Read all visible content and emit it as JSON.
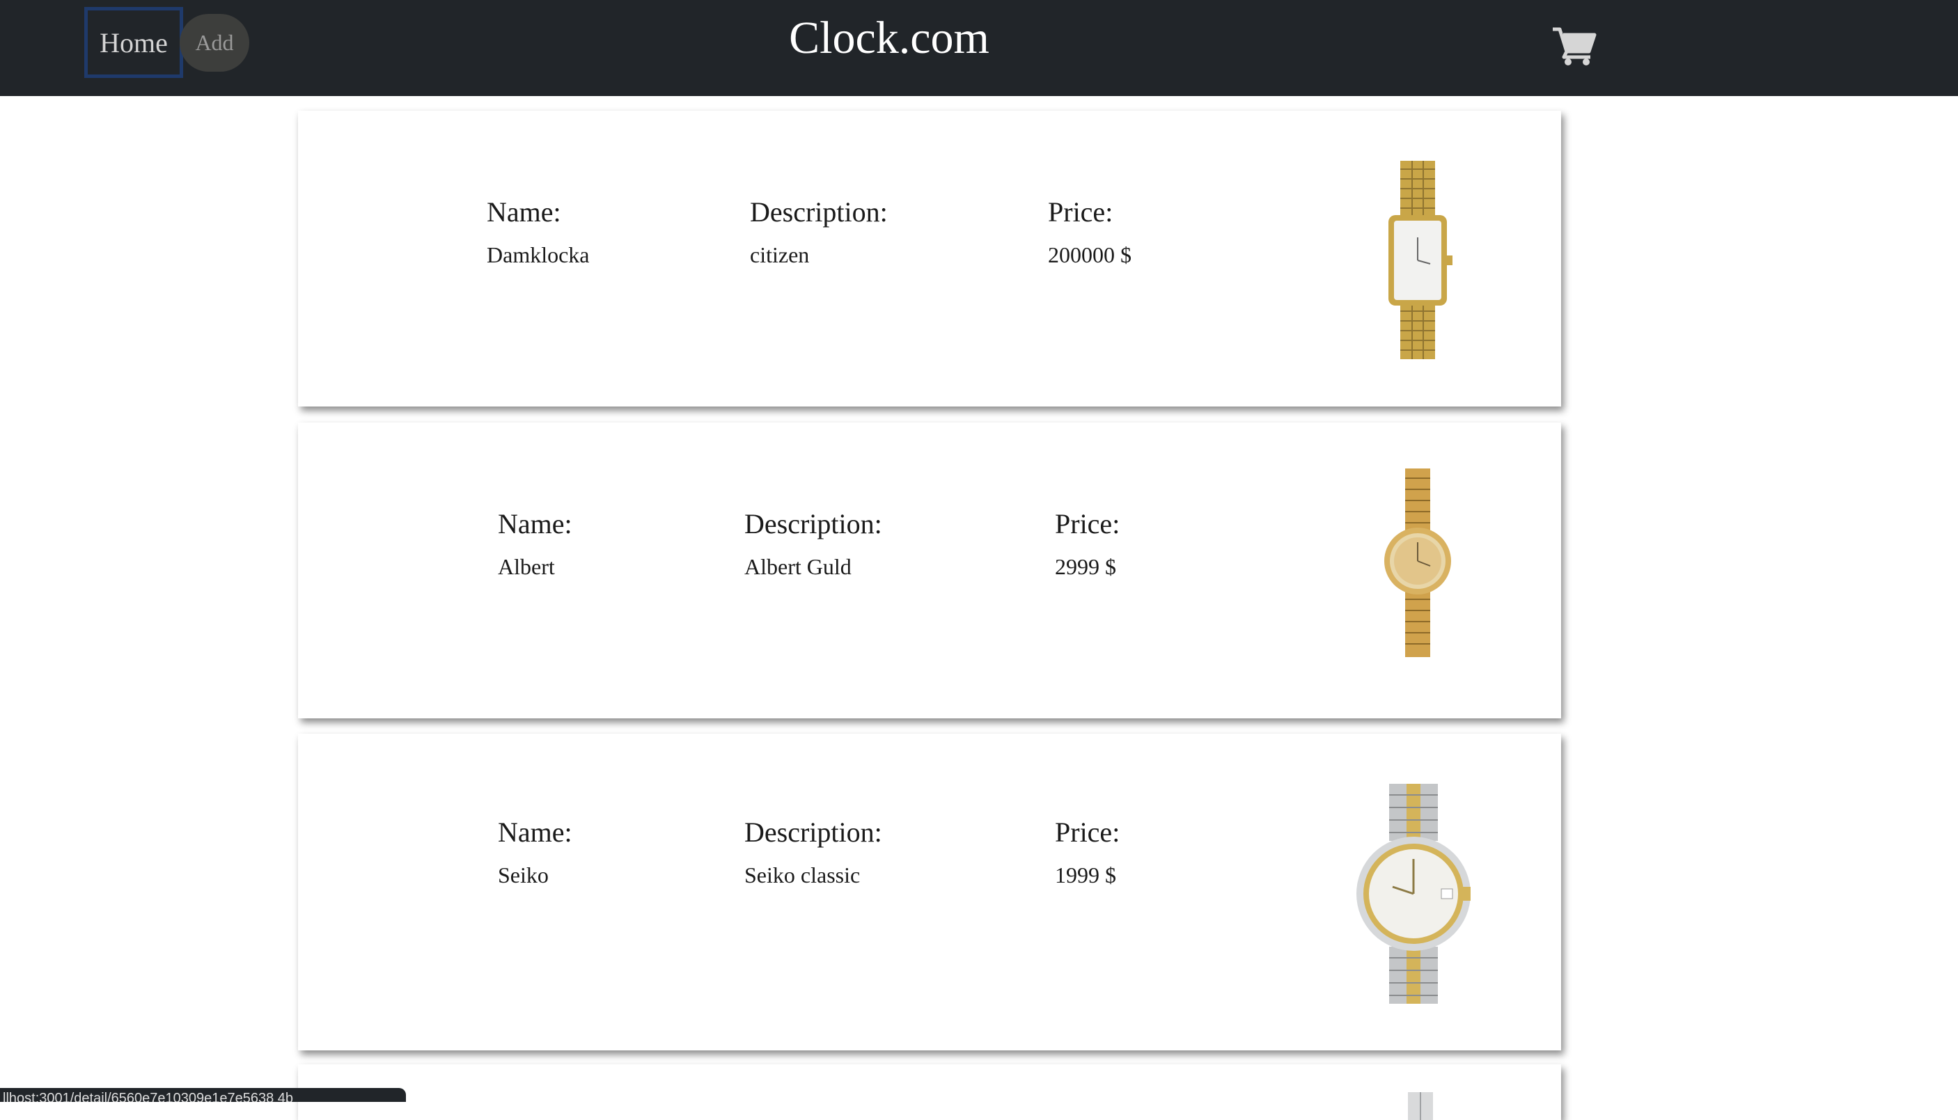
{
  "nav": {
    "home_label": "Home",
    "add_label": "Add",
    "brand": "Clock.com",
    "cart_icon": "shopping-cart-icon"
  },
  "products": [
    {
      "name_label": "Name:",
      "description_label": "Description:",
      "price_label": "Price:",
      "name": "Damklocka",
      "description": "citizen",
      "price": "200000 $",
      "image": "gold-rectangular-watch"
    },
    {
      "name_label": "Name:",
      "description_label": "Description:",
      "price_label": "Price:",
      "name": "Albert",
      "description": "Albert Guld",
      "price": "2999 $",
      "image": "gold-round-watch"
    },
    {
      "name_label": "Name:",
      "description_label": "Description:",
      "price_label": "Price:",
      "name": "Seiko",
      "description": "Seiko classic",
      "price": "1999 $",
      "image": "two-tone-seiko-watch"
    }
  ],
  "status_bar": {
    "url": "llhost:3001/detail/6560e7e10309e1e7e5638 4b"
  },
  "colors": {
    "navbar": "#212529",
    "home_border": "#1f3a6b",
    "add_pill": "#3d3e3c",
    "gold": "#c9a648",
    "silver": "#c4c6c8"
  }
}
